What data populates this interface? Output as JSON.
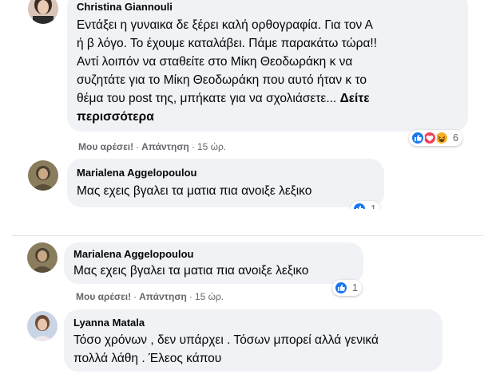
{
  "comments": [
    {
      "author": "Christina Giannouli",
      "lines": [
        "Εντάξει η γυναικα δε ξέρει καλή ορθογραφία. Για τον Α",
        "ή β λόγο. Το έχουμε καταλάβει. Πάμε παρακάτω τώρα!!",
        "Αντί λοιπόν να σταθείτε στο Μίκη Θεοδωράκη κ να",
        "συζητάτε για το Μίκη Θεοδωράκη που αυτό ήταν κ το",
        "θέμα του post της, μπήκατε για να σχολιάσετε..."
      ],
      "see_more_1": "Δείτε",
      "see_more_2": "περισσότερα",
      "like": "Μου αρέσει!",
      "reply": "Απάντηση",
      "time": "15 ώρ.",
      "reaction_count": "6"
    },
    {
      "author": "Marialena Aggelopoulou",
      "text": "Μας εχεις βγαλει τα ματια πια ανοιξε λεξικο",
      "reaction_count": "1"
    },
    {
      "author": "Marialena Aggelopoulou",
      "text": "Μας εχεις βγαλει τα ματια πια ανοιξε λεξικο",
      "like": "Μου αρέσει!",
      "reply": "Απάντηση",
      "time": "15 ώρ.",
      "reaction_count": "1"
    },
    {
      "author": "Lyanna Matala",
      "lines": [
        "Τόσο χρόνων , δεν υπάρχει . Τόσων μπορεί αλλά γενικά",
        "πολλά λάθη . Έλεος κάπου"
      ]
    }
  ],
  "separator": "·",
  "colors": {
    "bubble": "#f0f2f5",
    "like_blue": "#1877f2",
    "love_red": "#f33e58",
    "haha_yellow": "#f7b125",
    "meta_gray": "#65676b"
  }
}
